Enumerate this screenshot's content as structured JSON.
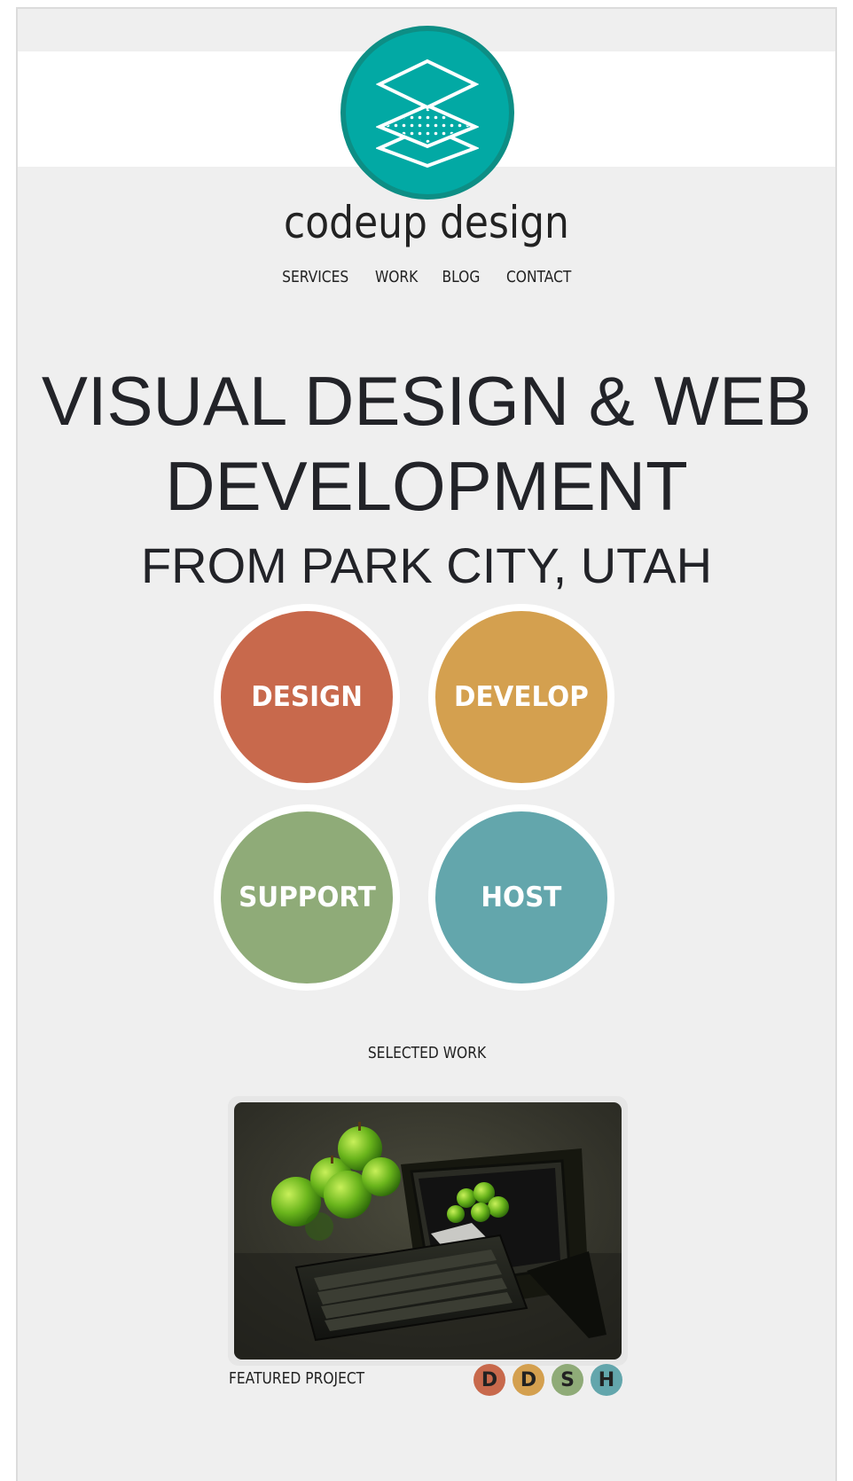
{
  "brand": {
    "name": "codeup design",
    "logo_icon": "layers-icon",
    "logo_color": "#02a9a4"
  },
  "nav": {
    "items": [
      {
        "label": "SERVICES"
      },
      {
        "label": "WORK"
      },
      {
        "label": "BLOG"
      },
      {
        "label": "CONTACT"
      }
    ]
  },
  "hero": {
    "headline_line1": "VISUAL DESIGN & WEB",
    "headline_line2": "DEVELOPMENT",
    "subheadline": "FROM PARK CITY, UTAH"
  },
  "services": [
    {
      "label": "DESIGN",
      "color": "#c8694c"
    },
    {
      "label": "DEVELOP",
      "color": "#d4a04f"
    },
    {
      "label": "SUPPORT",
      "color": "#8fab78"
    },
    {
      "label": "HOST",
      "color": "#63a6ac"
    }
  ],
  "work": {
    "section_title": "SELECTED WORK",
    "featured_label": "FEATURED PROJECT",
    "tags": [
      {
        "letter": "D",
        "color": "#c8694c"
      },
      {
        "letter": "D",
        "color": "#d4a04f"
      },
      {
        "letter": "S",
        "color": "#8fab78"
      },
      {
        "letter": "H",
        "color": "#63a6ac"
      }
    ]
  }
}
